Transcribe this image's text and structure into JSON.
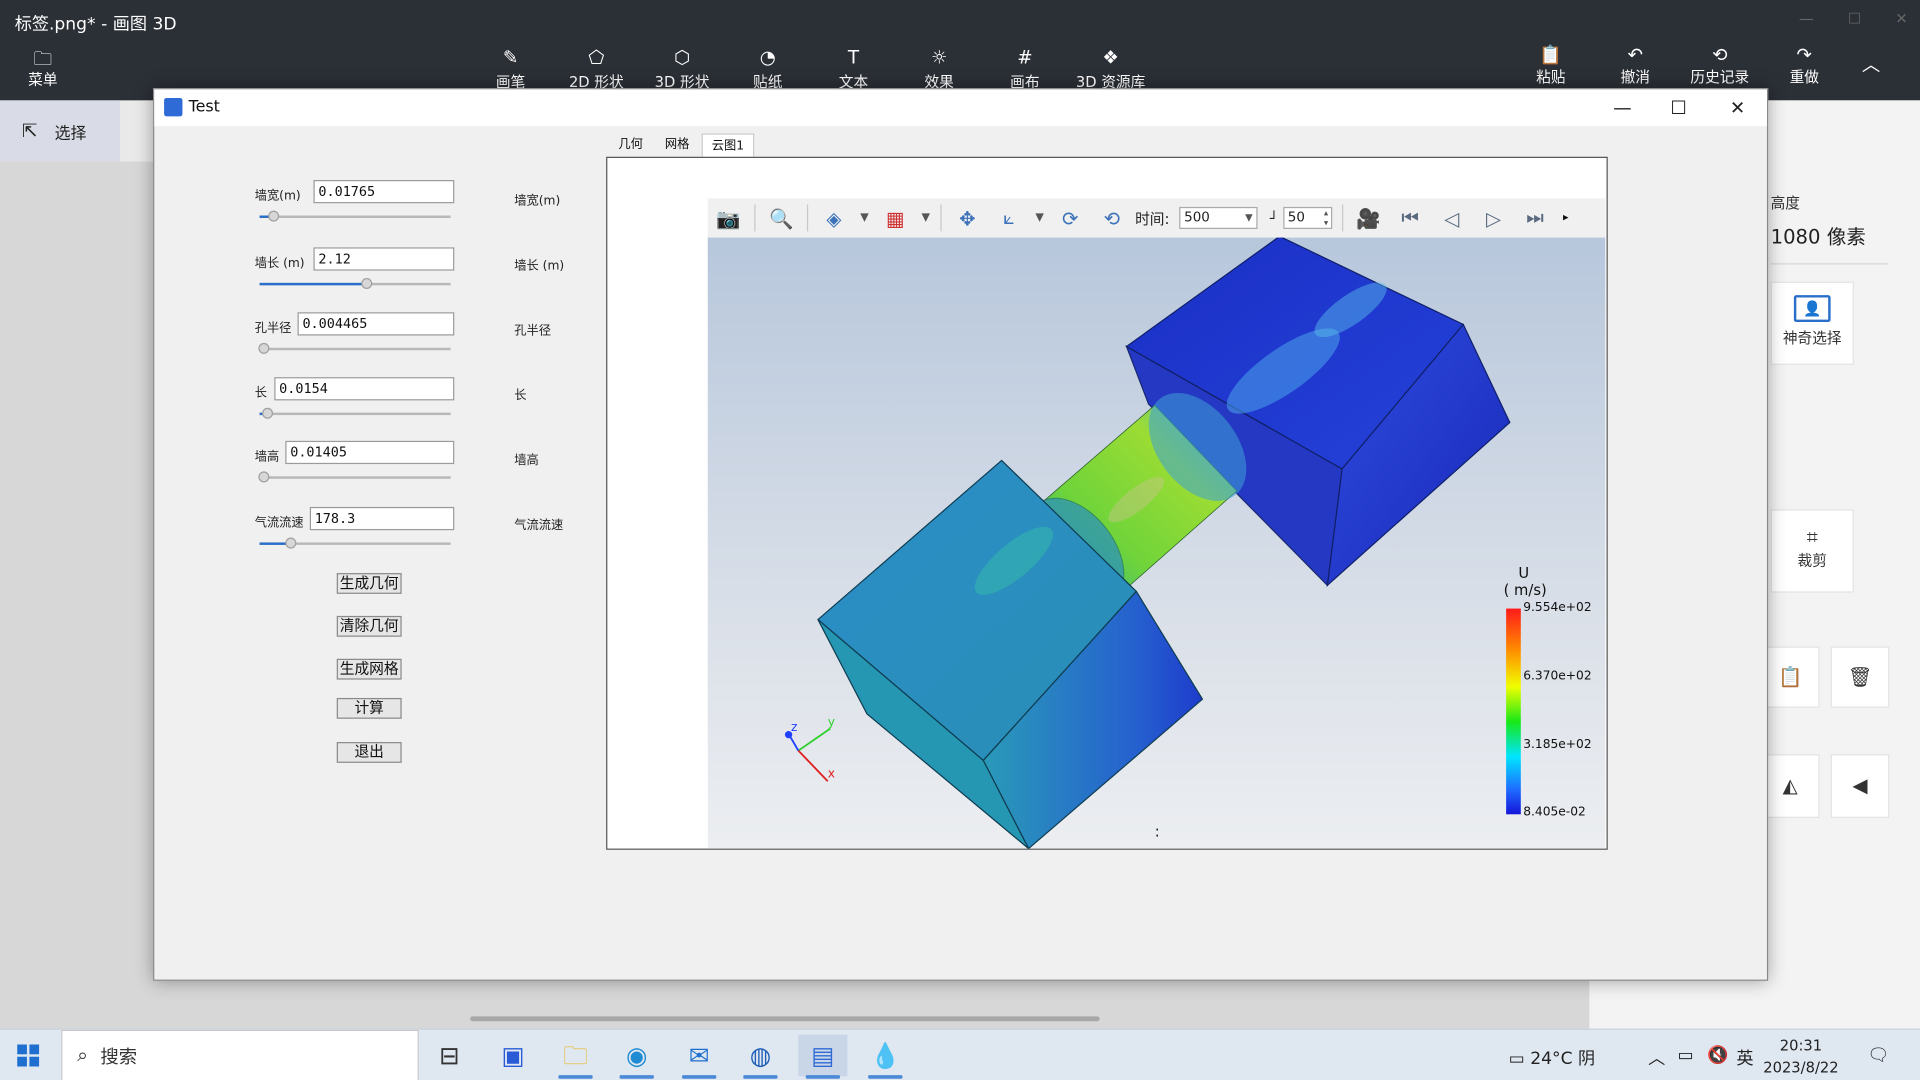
{
  "paint3d": {
    "title": "标签.png* - 画图 3D",
    "menu_label": "菜单",
    "tools": [
      {
        "icon": "brush-icon",
        "label": "画笔"
      },
      {
        "icon": "2d-shapes-icon",
        "label": "2D 形状"
      },
      {
        "icon": "3d-shapes-icon",
        "label": "3D 形状"
      },
      {
        "icon": "stickers-icon",
        "label": "贴纸"
      },
      {
        "icon": "text-icon",
        "label": "文本"
      },
      {
        "icon": "effects-icon",
        "label": "效果"
      },
      {
        "icon": "canvas-icon",
        "label": "画布"
      },
      {
        "icon": "3d-library-icon",
        "label": "3D 资源库"
      }
    ],
    "right_tools": [
      {
        "icon": "paste-icon",
        "label": "粘贴"
      },
      {
        "icon": "undo-icon",
        "label": "撤消"
      },
      {
        "icon": "history-icon",
        "label": "历史记录"
      },
      {
        "icon": "redo-icon",
        "label": "重做"
      }
    ],
    "select_label": "选择",
    "side_panel": {
      "height_label": "高度",
      "height_value": "1080 像素",
      "magic_select": "神奇选择",
      "crop": "裁剪"
    }
  },
  "app_window": {
    "title": "Test",
    "parameters": [
      {
        "label": "墙宽(m)",
        "value": "0.01765",
        "side_label": "墙宽(m)",
        "slider_fraction": 0.07
      },
      {
        "label": "墙长 (m)",
        "value": "2.12",
        "side_label": "墙长 (m)",
        "slider_fraction": 0.56
      },
      {
        "label": "孔半径",
        "value": "0.004465",
        "side_label": "孔半径",
        "slider_fraction": 0.02
      },
      {
        "label": "长",
        "value": "0.0154",
        "side_label": "长",
        "slider_fraction": 0.04
      },
      {
        "label": "墙高",
        "value": "0.01405",
        "side_label": "墙高",
        "slider_fraction": 0.02
      },
      {
        "label": "气流流速",
        "value": "178.3",
        "side_label": "气流流速",
        "slider_fraction": 0.16
      }
    ],
    "buttons": {
      "generate_geometry": "生成几何",
      "clear_geometry": "清除几何",
      "generate_mesh": "生成网格",
      "compute": "计算",
      "exit": "退出"
    },
    "tabs": [
      "几何",
      "网格",
      "云图1"
    ],
    "active_tab": "云图1",
    "viewer": {
      "time_label": "时间:",
      "time_value": "500",
      "step_value": "50",
      "legend": {
        "title": "U",
        "unit": "( m/s)",
        "ticks": [
          "9.554e+02",
          "6.370e+02",
          "3.185e+02",
          "8.405e-02"
        ]
      },
      "axes": {
        "x": "x",
        "y": "y",
        "z": "z"
      },
      "colors": {
        "background_top": "#b7c7dc",
        "background_bottom": "#eceef1"
      }
    }
  },
  "taskbar": {
    "search_placeholder": "搜索",
    "weather": "24°C 阴",
    "ime": "英",
    "time": "20:31",
    "date": "2023/8/22",
    "apps": [
      "task-view-icon",
      "store-icon",
      "file-explorer-icon",
      "edge-icon",
      "mail-icon",
      "app-icon",
      "test-app-icon",
      "paint3d-icon"
    ]
  }
}
